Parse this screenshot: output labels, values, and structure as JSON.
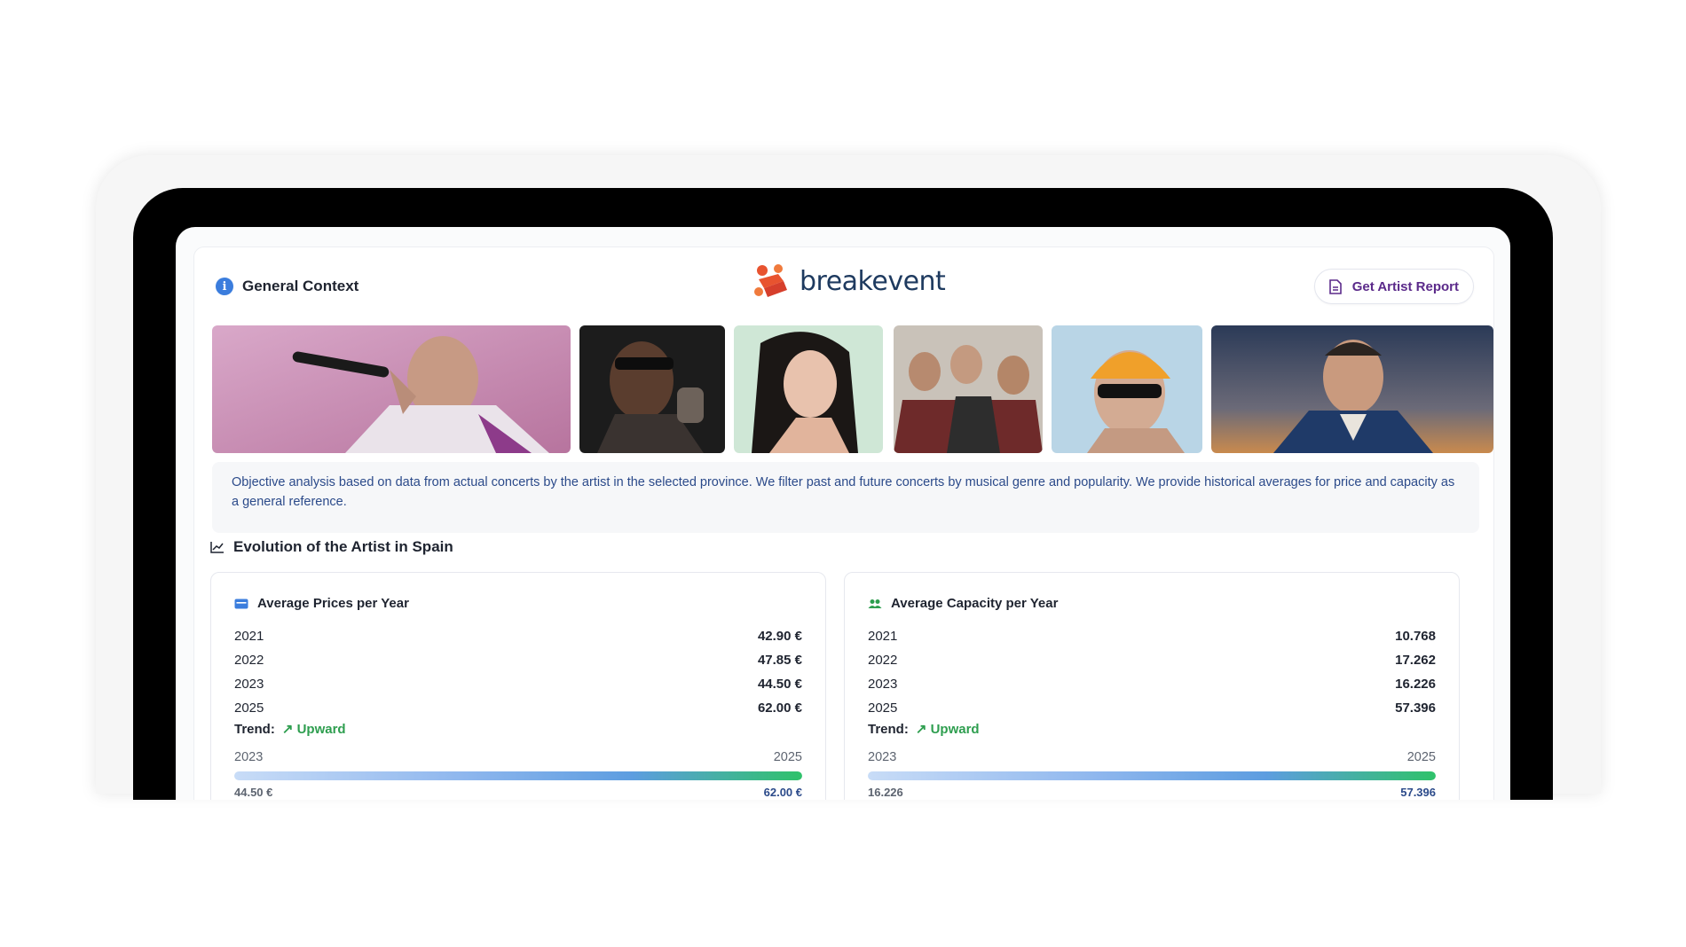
{
  "header": {
    "title": "General Context",
    "brand": "breakevent",
    "report_button": "Get Artist Report"
  },
  "photos": [
    {
      "name": "artist-photo-1"
    },
    {
      "name": "artist-photo-2"
    },
    {
      "name": "artist-photo-3"
    },
    {
      "name": "artist-photo-4"
    },
    {
      "name": "artist-photo-5"
    },
    {
      "name": "artist-photo-6"
    }
  ],
  "description": "Objective analysis based on data from actual concerts by the artist in the selected province. We filter past and future concerts by musical genre and popularity. We provide historical averages for price and capacity as a general reference.",
  "section": {
    "title": "Evolution of the Artist in Spain"
  },
  "prices": {
    "title": "Average Prices per Year",
    "rows": [
      {
        "year": "2021",
        "value": "42.90 €"
      },
      {
        "year": "2022",
        "value": "47.85 €"
      },
      {
        "year": "2023",
        "value": "44.50 €"
      },
      {
        "year": "2025",
        "value": "62.00 €"
      }
    ],
    "trend_label": "Trend:",
    "trend_value": "↗ Upward",
    "range_start": "2023",
    "range_end": "2025",
    "range_start_value": "44.50 €",
    "range_end_value": "62.00 €",
    "fill_fraction": 1.0
  },
  "capacity": {
    "title": "Average Capacity per Year",
    "rows": [
      {
        "year": "2021",
        "value": "10.768"
      },
      {
        "year": "2022",
        "value": "17.262"
      },
      {
        "year": "2023",
        "value": "16.226"
      },
      {
        "year": "2025",
        "value": "57.396"
      }
    ],
    "trend_label": "Trend:",
    "trend_value": "↗ Upward",
    "range_start": "2023",
    "range_end": "2025",
    "range_start_value": "16.226",
    "range_end_value": "57.396",
    "fill_fraction": 1.0
  },
  "colors": {
    "accent_blue": "#3b7ddd",
    "trend_green": "#2e9e4f",
    "brand_orange": "#e8532f",
    "brand_navy": "#1e3a5f",
    "report_purple": "#5b2a8a"
  }
}
